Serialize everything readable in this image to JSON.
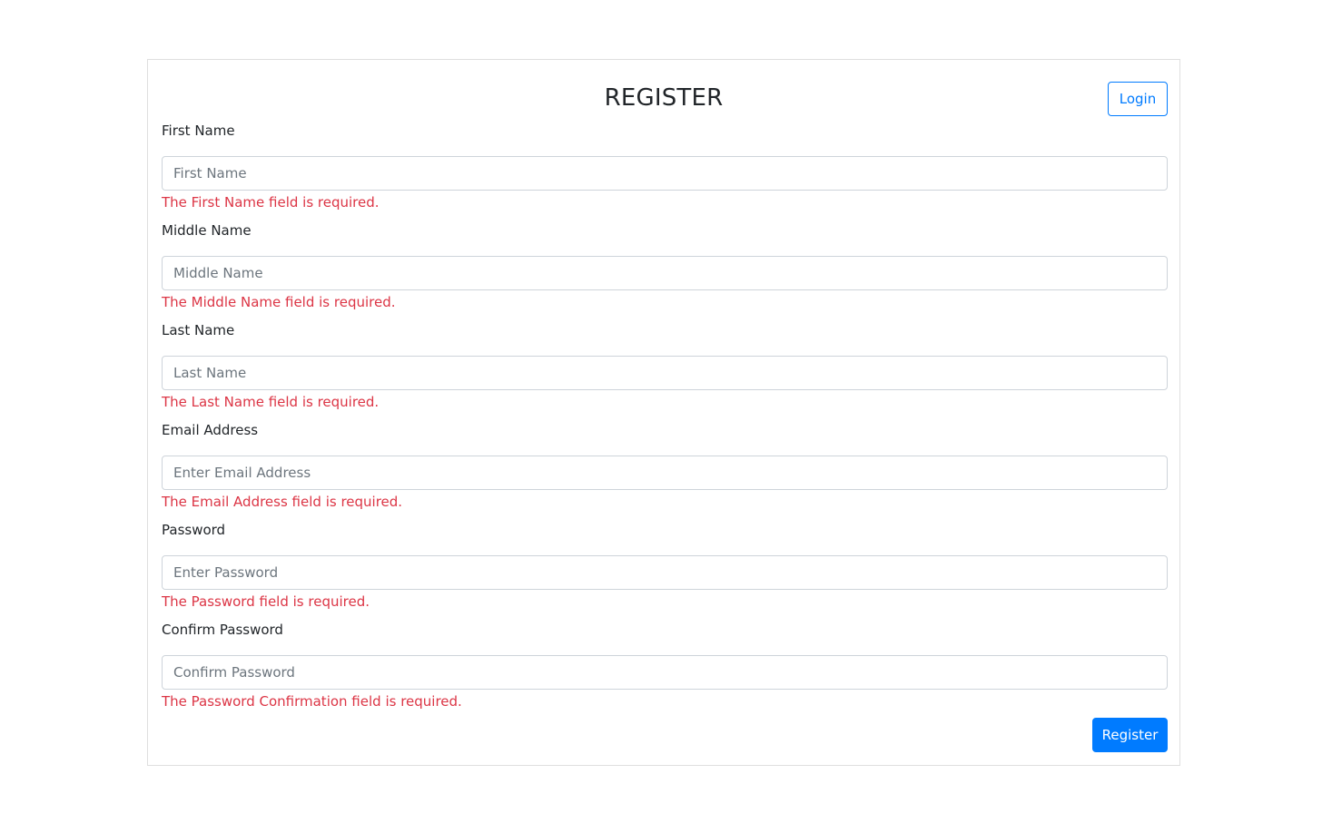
{
  "header": {
    "title": "REGISTER",
    "login_label": "Login"
  },
  "fields": [
    {
      "label": "First Name",
      "placeholder": "First Name",
      "value": "",
      "error": "The First Name field is required."
    },
    {
      "label": "Middle Name",
      "placeholder": "Middle Name",
      "value": "",
      "error": "The Middle Name field is required."
    },
    {
      "label": "Last Name",
      "placeholder": "Last Name",
      "value": "",
      "error": "The Last Name field is required."
    },
    {
      "label": "Email Address",
      "placeholder": "Enter Email Address",
      "value": "",
      "error": "The Email Address field is required."
    },
    {
      "label": "Password",
      "placeholder": "Enter Password",
      "value": "",
      "error": "The Password field is required."
    },
    {
      "label": "Confirm Password",
      "placeholder": "Confirm Password",
      "value": "",
      "error": "The Password Confirmation field is required."
    }
  ],
  "actions": {
    "register_label": "Register"
  },
  "colors": {
    "primary": "#007bff",
    "error": "#dc3545",
    "text": "#212529",
    "placeholder": "#6c757d",
    "input_border": "#ced4da"
  }
}
